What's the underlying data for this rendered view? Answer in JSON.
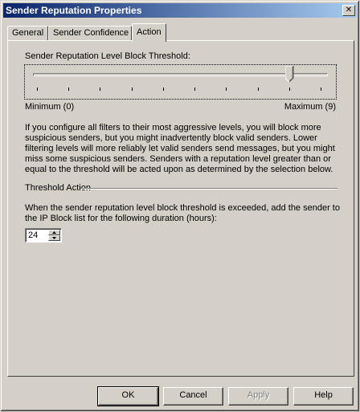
{
  "window": {
    "title": "Sender Reputation Properties",
    "close_label": "✕"
  },
  "tabs": [
    {
      "label": "General"
    },
    {
      "label": "Sender Confidence"
    },
    {
      "label": "Action"
    }
  ],
  "slider": {
    "label": "Sender Reputation Level Block Threshold:",
    "min_label": "Minimum (0)",
    "max_label": "Maximum (9)",
    "min": 0,
    "max": 9,
    "value": 8
  },
  "description": "If you configure all filters to their most aggressive levels, you will block more suspicious senders, but you might inadvertently block valid senders. Lower filtering levels will more reliably let valid senders send messages, but you might miss some suspicious senders. Senders with a reputation level greater than or equal to the threshold will be acted upon as determined by the selection below.",
  "threshold_action": {
    "heading": "Threshold Action",
    "text": "When the sender reputation level block threshold is exceeded, add the sender to the IP Block list for the following duration (hours):",
    "duration_value": "24"
  },
  "buttons": {
    "ok": "OK",
    "cancel": "Cancel",
    "apply": "Apply",
    "help": "Help"
  },
  "icons": {
    "close": "close-icon",
    "spin_up": "arrow-up-icon",
    "spin_down": "arrow-down-icon"
  }
}
